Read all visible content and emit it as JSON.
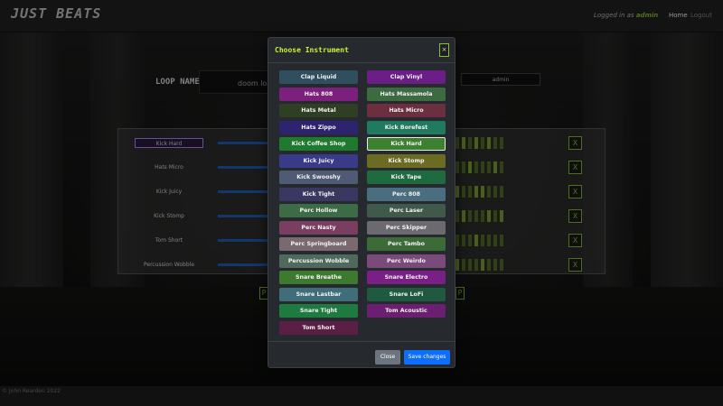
{
  "nav": {
    "brand": "JUST BEATS",
    "logged_prefix": "Logged in as",
    "user": "admin",
    "home": "Home",
    "logout": "Logout"
  },
  "loop": {
    "label": "LOOP NAME",
    "name_value": "doom loop",
    "user_value": "admin"
  },
  "tracks": [
    {
      "name": "Kick Hard"
    },
    {
      "name": "Hats Micro"
    },
    {
      "name": "Kick Juicy"
    },
    {
      "name": "Kick Stomp"
    },
    {
      "name": "Tom Short"
    },
    {
      "name": "Percussion Wobble"
    }
  ],
  "delete_label": "X",
  "bg_buttons": {
    "left": "P",
    "right": "P"
  },
  "footer": "© John Rearden 2022",
  "modal": {
    "title": "Choose Instrument",
    "close_x": "×",
    "close_label": "Close",
    "save_label": "Save changes",
    "instruments": [
      {
        "label": "Clap Liquid",
        "color": "#2f4f5f"
      },
      {
        "label": "Clap Vinyl",
        "color": "#6b1f86"
      },
      {
        "label": "Hats 808",
        "color": "#7d1f7d"
      },
      {
        "label": "Hats Massamola",
        "color": "#3d6b40"
      },
      {
        "label": "Hats Metal",
        "color": "#2e3f24"
      },
      {
        "label": "Hats Micro",
        "color": "#6b2f40"
      },
      {
        "label": "Hats Zippo",
        "color": "#2d2470"
      },
      {
        "label": "Kick Borefest",
        "color": "#1f7a5f"
      },
      {
        "label": "Kick Coffee Shop",
        "color": "#1e7a2e"
      },
      {
        "label": "Kick Hard",
        "color": "#3d8030",
        "selected": true
      },
      {
        "label": "Kick Juicy",
        "color": "#3a3a8a"
      },
      {
        "label": "Kick Stomp",
        "color": "#6b6b24"
      },
      {
        "label": "Kick Swooshy",
        "color": "#4f5a75"
      },
      {
        "label": "Kick Tape",
        "color": "#1f6b40"
      },
      {
        "label": "Kick Tight",
        "color": "#3a3760"
      },
      {
        "label": "Perc 808",
        "color": "#4a6e80"
      },
      {
        "label": "Perc Hollow",
        "color": "#3d6b45"
      },
      {
        "label": "Perc Laser",
        "color": "#3f5a4a"
      },
      {
        "label": "Perc Nasty",
        "color": "#7a3f60"
      },
      {
        "label": "Perc Skipper",
        "color": "#6a6a70"
      },
      {
        "label": "Perc Springboard",
        "color": "#7a6a70"
      },
      {
        "label": "Perc Tambo",
        "color": "#3d6b38"
      },
      {
        "label": "Percussion Wobble",
        "color": "#4f6a5a"
      },
      {
        "label": "Perc Weirdo",
        "color": "#7a4a7a"
      },
      {
        "label": "Snare Breathe",
        "color": "#3d7a30"
      },
      {
        "label": "Snare Electro",
        "color": "#7a1f86"
      },
      {
        "label": "Snare Lastbar",
        "color": "#3f6e7a"
      },
      {
        "label": "Snare LoFi",
        "color": "#1f5a40"
      },
      {
        "label": "Snare Tight",
        "color": "#1f7a40"
      },
      {
        "label": "Tom Acoustic",
        "color": "#6b1f70"
      },
      {
        "label": "Tom Short",
        "color": "#5a1f45"
      }
    ]
  }
}
